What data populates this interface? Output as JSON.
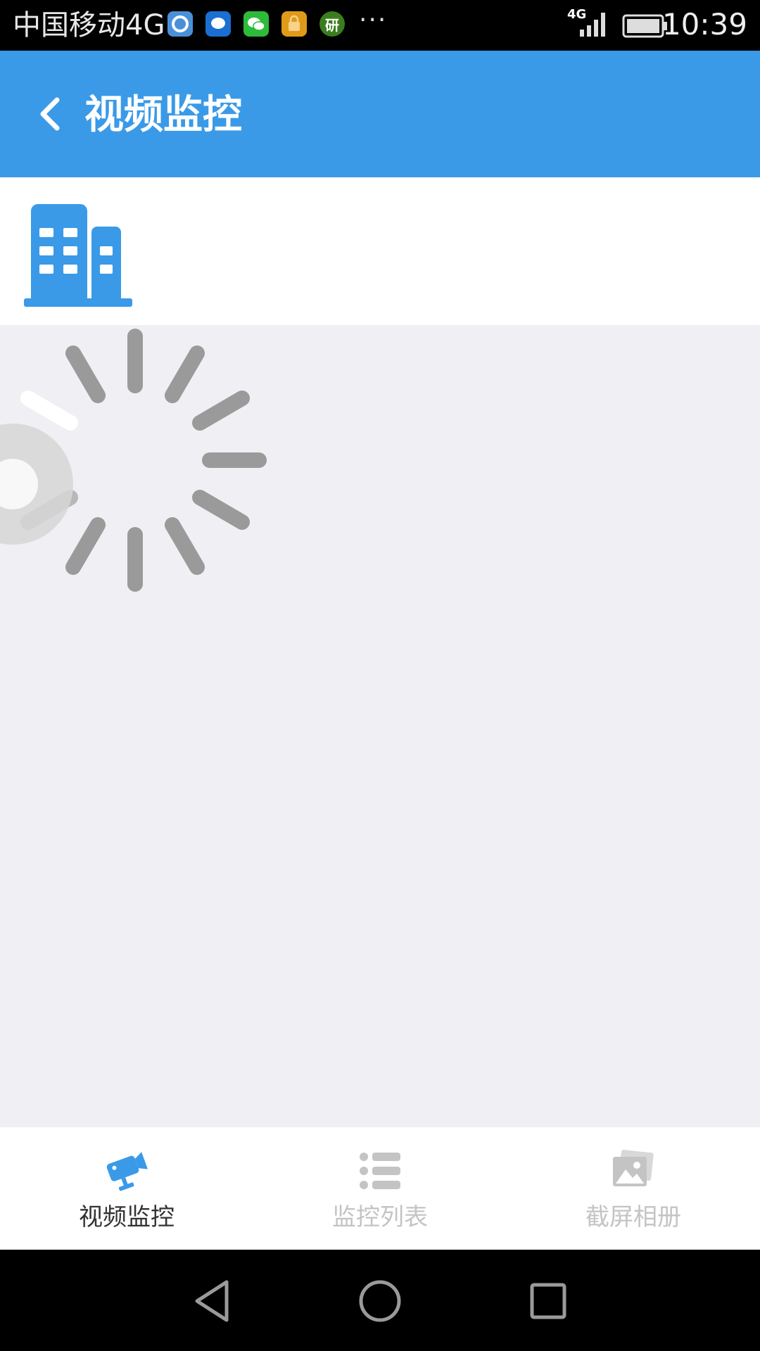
{
  "status_bar": {
    "carrier": "中国移动4G",
    "notification_icons": [
      {
        "name": "qq-browser-icon",
        "color": "#4a90d9",
        "glyph": ""
      },
      {
        "name": "chat-bubble-icon",
        "color": "#1a6fd0",
        "glyph": ""
      },
      {
        "name": "wechat-icon",
        "color": "#2dbb3a",
        "glyph": ""
      },
      {
        "name": "lock-app-icon",
        "color": "#e09a1a",
        "glyph": ""
      },
      {
        "name": "yan-app-icon",
        "color": "#3a7d1e",
        "glyph": "研"
      }
    ],
    "more": "···",
    "network": "4G",
    "time": "10:39"
  },
  "header": {
    "title": "视频监控",
    "back_icon": "chevron-left-icon"
  },
  "site": {
    "icon": "building-icon",
    "color": "#3a9ae8"
  },
  "loading": {
    "icon": "spinner-icon"
  },
  "tabs": [
    {
      "label": "视频监控",
      "icon": "camera-icon",
      "active": true
    },
    {
      "label": "监控列表",
      "icon": "list-icon",
      "active": false
    },
    {
      "label": "截屏相册",
      "icon": "gallery-icon",
      "active": false
    }
  ],
  "colors": {
    "accent": "#3a9ae8",
    "tab_active_text": "#333333",
    "tab_inactive": "#c4c4c4",
    "background": "#efeff4"
  },
  "nav": {
    "back": "nav-back-icon",
    "home": "nav-home-icon",
    "recents": "nav-recents-icon"
  }
}
